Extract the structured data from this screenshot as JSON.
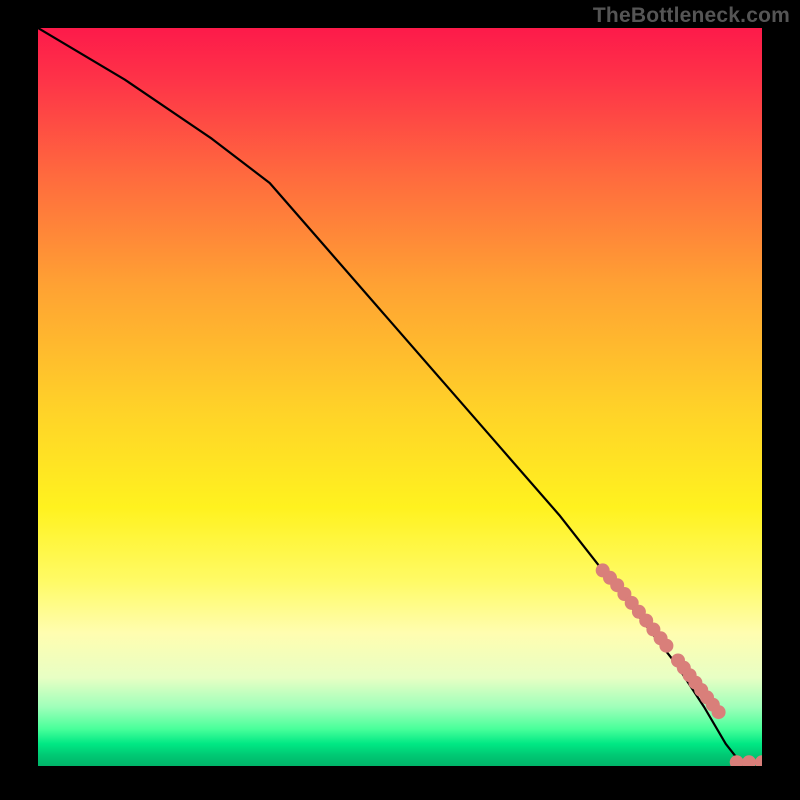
{
  "watermark": "TheBottleneck.com",
  "chart_data": {
    "type": "line",
    "title": "",
    "xlabel": "",
    "ylabel": "",
    "xlim": [
      0,
      100
    ],
    "ylim": [
      0,
      100
    ],
    "grid": false,
    "legend": false,
    "series": [
      {
        "name": "curve",
        "style": "black-line",
        "x": [
          0,
          12,
          24,
          32,
          40,
          48,
          56,
          64,
          72,
          80,
          88,
          92,
          95,
          97,
          100
        ],
        "y": [
          100,
          93,
          85,
          79,
          70,
          61,
          52,
          43,
          34,
          24,
          14,
          8,
          3,
          0.5,
          0.5
        ]
      },
      {
        "name": "tail-markers",
        "style": "salmon-dots",
        "x": [
          78,
          79,
          80,
          81,
          82,
          83,
          84,
          85,
          86,
          86.8,
          88.4,
          89.2,
          90,
          90.8,
          91.6,
          92.4,
          93.2,
          94,
          96.5,
          98.2,
          100
        ],
        "y": [
          26.5,
          25.5,
          24.5,
          23.3,
          22.1,
          20.9,
          19.7,
          18.5,
          17.3,
          16.3,
          14.3,
          13.3,
          12.3,
          11.3,
          10.3,
          9.3,
          8.3,
          7.3,
          0.5,
          0.5,
          0.5
        ]
      }
    ],
    "background_gradient": {
      "orientation": "vertical",
      "stops": [
        {
          "pos": 0,
          "color": "#fd1a4a"
        },
        {
          "pos": 0.35,
          "color": "#ffa233"
        },
        {
          "pos": 0.65,
          "color": "#fff21f"
        },
        {
          "pos": 0.92,
          "color": "#9fffba"
        },
        {
          "pos": 1.0,
          "color": "#00b469"
        }
      ]
    }
  }
}
